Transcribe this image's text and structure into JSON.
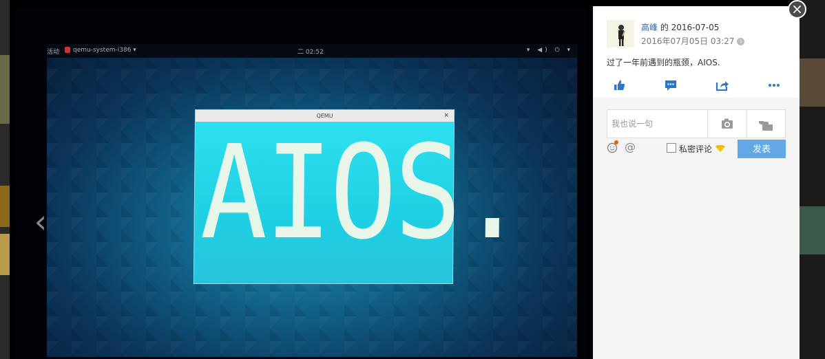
{
  "viewer": {
    "prev_label": "‹",
    "next_label": "›",
    "photo": {
      "gnome": {
        "activities": "活动",
        "app_menu": "qemu-system-i386 ▾",
        "clock": "二 02:52",
        "sys_icons": "▾ ◀) ⏻ ▾"
      },
      "qemu_title": "QEMU",
      "qemu_close": "×",
      "screen_text": "AIOS."
    }
  },
  "post": {
    "author": "高峰",
    "author_suffix": " 的 2016-07-05",
    "timestamp": "2016年07月05日 03:27",
    "info_icon": "i",
    "text": "过了一年前遇到的瓶颈，AIOS.",
    "actions": [
      "like-icon",
      "comment-icon",
      "share-icon",
      "more-icon"
    ]
  },
  "comment": {
    "placeholder": "我也说一句",
    "at": "@",
    "private_label": "私密评论",
    "submit_label": "发表"
  },
  "close_label": "×",
  "colors": {
    "accent": "#63a8e4",
    "link": "#2b63a8",
    "vip": "#f5c400",
    "notify": "#f55a00"
  }
}
